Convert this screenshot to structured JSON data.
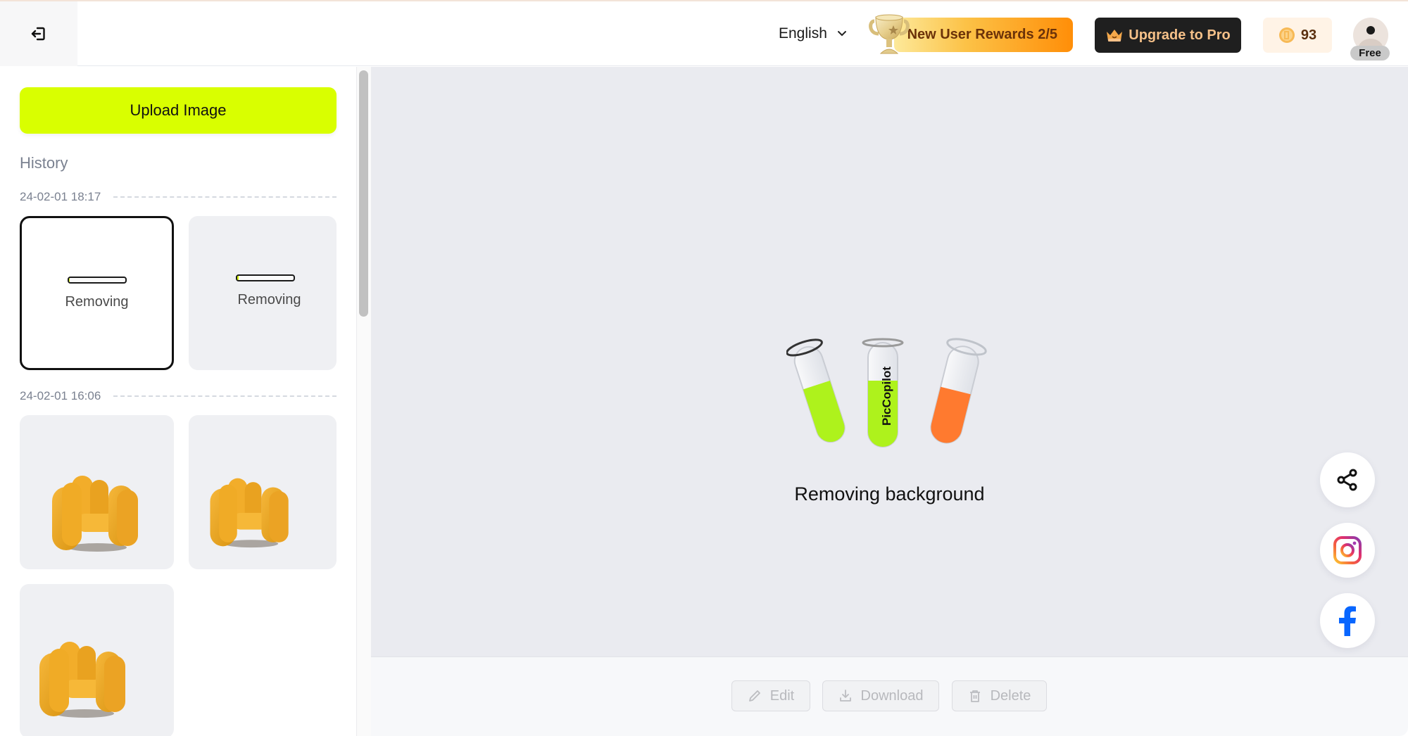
{
  "header": {
    "language": "English",
    "rewards_label": "New User Rewards 2/5",
    "upgrade_label": "Upgrade to Pro",
    "coins": "93",
    "plan_badge": "Free"
  },
  "sidebar": {
    "upload_label": "Upload Image",
    "history_label": "History",
    "groups": [
      {
        "date": "24-02-01 18:17",
        "items": [
          {
            "status": "Removing",
            "progress": 0.02,
            "selected": true
          },
          {
            "status": "Removing",
            "progress": 0.02,
            "selected": false
          }
        ]
      },
      {
        "date": "24-02-01 16:06",
        "items": [
          {
            "thumbnail": "yellow-armchair"
          },
          {
            "thumbnail": "yellow-armchair"
          },
          {
            "thumbnail": "yellow-armchair"
          }
        ]
      }
    ]
  },
  "main": {
    "loader_brand": "PicCopilot",
    "loader_text": "Removing background",
    "colors": {
      "accent": "#d9ff00",
      "orange_liquid": "#ff7a2f",
      "canvas_bg": "#eaebf0"
    }
  },
  "social": [
    {
      "icon": "share-icon"
    },
    {
      "icon": "instagram-icon"
    },
    {
      "icon": "facebook-icon"
    }
  ],
  "toolbar": {
    "edit_label": "Edit",
    "download_label": "Download",
    "delete_label": "Delete"
  }
}
